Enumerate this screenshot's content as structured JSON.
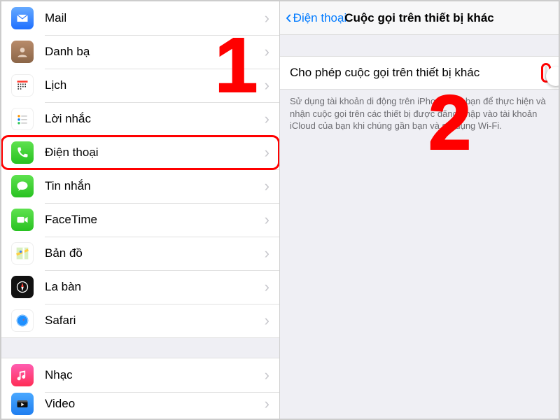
{
  "left": {
    "items": [
      {
        "key": "mail",
        "label": "Mail"
      },
      {
        "key": "contacts",
        "label": "Danh bạ"
      },
      {
        "key": "calendar",
        "label": "Lịch"
      },
      {
        "key": "reminders",
        "label": "Lời nhắc"
      },
      {
        "key": "phone",
        "label": "Điện thoại",
        "highlighted": true
      },
      {
        "key": "messages",
        "label": "Tin nhắn"
      },
      {
        "key": "facetime",
        "label": "FaceTime"
      },
      {
        "key": "maps",
        "label": "Bản đồ"
      },
      {
        "key": "compass",
        "label": "La bàn"
      },
      {
        "key": "safari",
        "label": "Safari"
      }
    ],
    "items2": [
      {
        "key": "music",
        "label": "Nhạc"
      },
      {
        "key": "video",
        "label": "Video"
      }
    ]
  },
  "right": {
    "back_label": "Điện thoại",
    "title": "Cuộc gọi trên thiết bị khác",
    "toggle_label": "Cho phép cuộc gọi trên thiết bị khác",
    "toggle_on": false,
    "description": "Sử dụng tài khoản di động trên iPhone của bạn để thực hiện và nhận cuộc gọi trên các thiết bị được đăng nhập vào tài khoản iCloud của bạn khi chúng gần bạn và sử dụng Wi-Fi."
  },
  "annotations": {
    "one": "1",
    "two": "2"
  }
}
